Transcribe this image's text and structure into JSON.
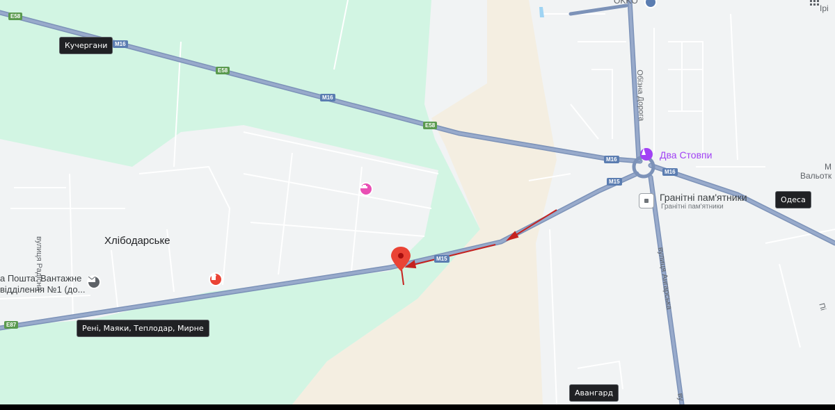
{
  "colors": {
    "land": "#f1f3f4",
    "green_area": "#d2f5e3",
    "sand_area": "#f4eee1",
    "highway": "#8ea2c2",
    "highway_edge": "#7c92b8",
    "minor_road": "#ffffff",
    "route_arrow": "#c5221f",
    "pin": "#ea4335",
    "poi_pink": "#e94fb4",
    "poi_purple": "#a142f4"
  },
  "places": {
    "town": "Хлібодарське",
    "landmark_1": "Два Стовпи",
    "landmark_2_title": "Гранітні пам'ятники",
    "landmark_2_subtitle": "Гранітні пам'ятники",
    "post_office_line1": "а Пошта. Вантажне",
    "post_office_line2": "відділення №1 (до...",
    "station_top": "OKKO",
    "edge_top_right": "Ірі",
    "edge_right_1": "М",
    "edge_right_2": "Вальотк",
    "edge_right_3": "Пі"
  },
  "streets": {
    "radisna": "вулиця Радісна",
    "obizna": "Обїзна Дорога",
    "angarska": "вулиця Ангарська",
    "angarska_cut": "ву"
  },
  "callouts": {
    "kuchergany": "Кучергани",
    "odesa": "Одеса",
    "reni": "Рені, Маяки, Теплодар, Мирне",
    "avangard": "Авангард"
  },
  "shields": {
    "e58_a": "E58",
    "e58_b": "E58",
    "e58_c": "E58",
    "m16_a": "M16",
    "m16_b": "M16",
    "m16_c": "M16",
    "m16_d": "M16",
    "m15_a": "M15",
    "m15_b": "M15",
    "e87": "E87"
  },
  "icons": {
    "hotel": "hotel-icon",
    "landmark": "monument-icon",
    "shop": "shop-icon",
    "post": "mail-icon",
    "place_marker": "place-pin-icon",
    "apps": "apps-grid-icon",
    "fuel": "fuel-station-icon"
  }
}
